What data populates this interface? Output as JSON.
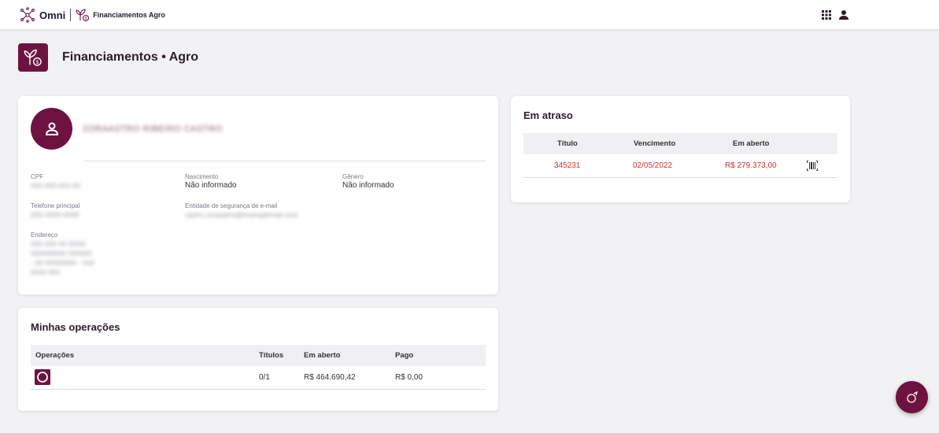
{
  "topbar": {
    "brand_name": "Omni",
    "app_name": "Financiamentos Agro",
    "apps_icon": "grid-icon",
    "user_icon": "user-icon"
  },
  "page": {
    "title": "Financiamentos • Agro",
    "icon": "plant-money-icon"
  },
  "profile": {
    "avatar_icon": "user-icon",
    "name": "ZORAASTRO RIBEIRO CASTRO",
    "fields": {
      "cpf": {
        "label": "CPF",
        "value": "000.000.001-00"
      },
      "nascimento": {
        "label": "Nascimento",
        "value": "Não informado"
      },
      "genero": {
        "label": "Gênero",
        "value": "Não informado"
      },
      "telefone": {
        "label": "Telefone principal",
        "value": "(00) 0000-0000"
      },
      "email": {
        "label": "Entidade de segurança de e-mail",
        "value": "castro.zoraastro@examplemail.com"
      },
      "endereco": {
        "label": "Endereço",
        "lines": [
          "000 000 00 00/00",
          "000000000 000000",
          "- 00 00000000 - 000",
          "0000 000"
        ]
      }
    }
  },
  "operations": {
    "title": "Minhas operações",
    "headers": [
      "Operações",
      "Títulos",
      "Em aberto",
      "Pago"
    ],
    "rows": [
      {
        "icon": "circle-progress-icon",
        "titulos": "0/1",
        "em_aberto": "R$ 464.690,42",
        "pago": "R$ 0,00"
      }
    ]
  },
  "late": {
    "title": "Em atraso",
    "headers": [
      "Título",
      "Vencimento",
      "Em aberto"
    ],
    "rows": [
      {
        "titulo": "345231",
        "vencimento": "02/05/2022",
        "em_aberto": "R$ 279.373,00",
        "action_icon": "barcode-icon"
      }
    ]
  },
  "colors": {
    "brand": "#6e1240",
    "late_text": "#d0302f"
  },
  "fab_icon": "chat-icon"
}
